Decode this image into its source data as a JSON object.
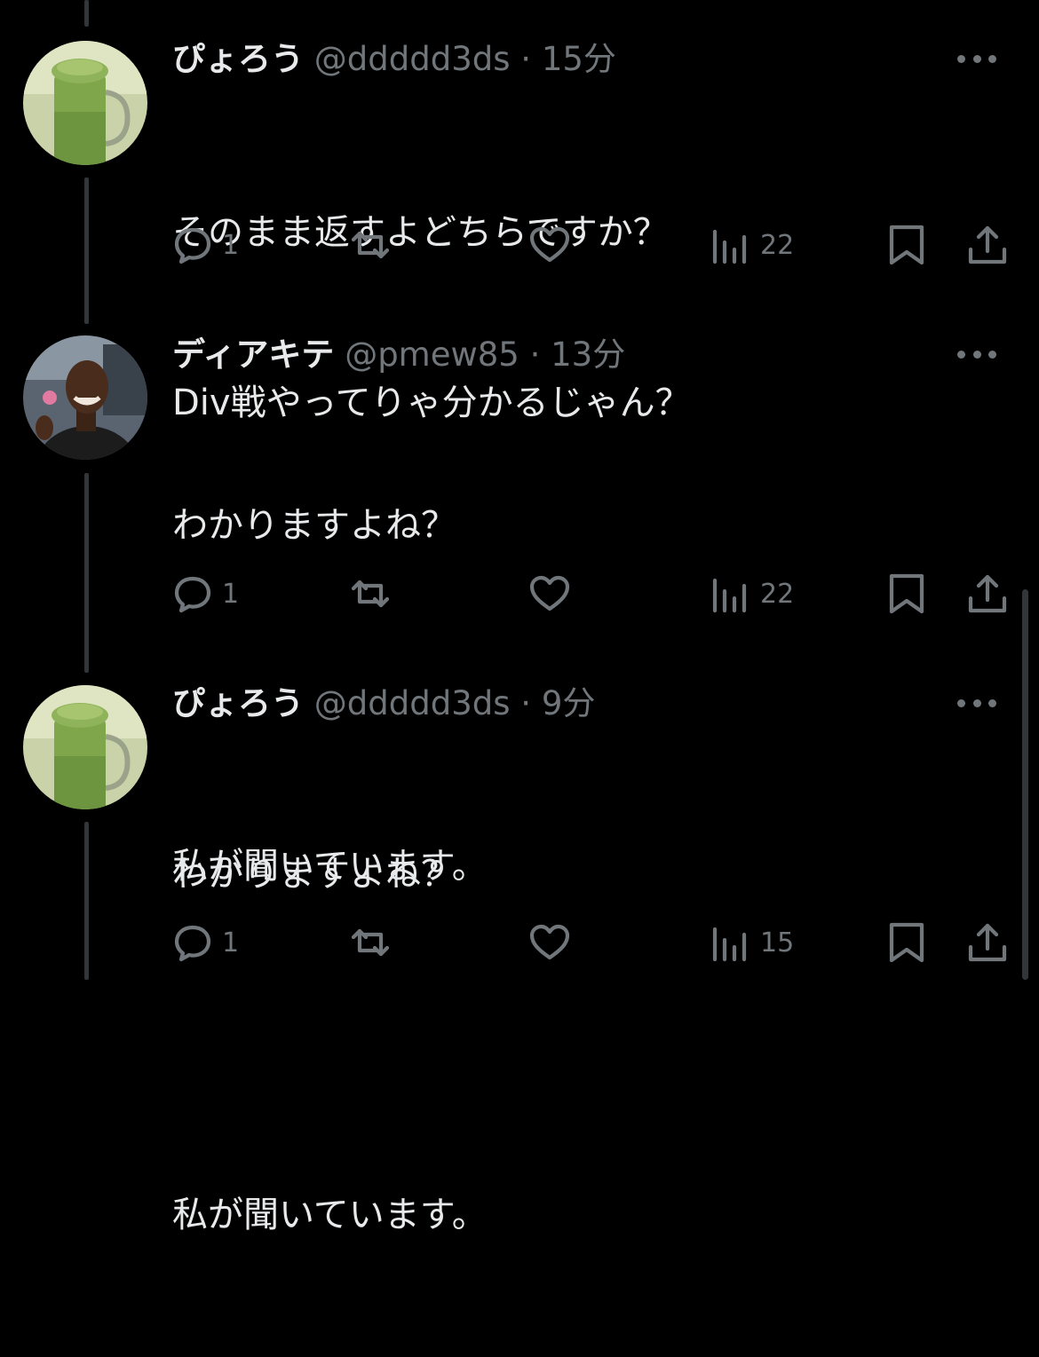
{
  "tweets": [
    {
      "name": "ぴょろう",
      "handle": "@ddddd3ds",
      "separator": "·",
      "time": "15分",
      "lines": [
        "そのまま返すよどちらですか？",
        "Div戦やってりゃ分かるじゃん？"
      ],
      "replies": "1",
      "views": "22",
      "avatar": "matcha-latte"
    },
    {
      "name": "ディアキテ",
      "handle": "@pmew85",
      "separator": "·",
      "time": "13分",
      "lines": [
        "わかりますよね？",
        "",
        "私が聞いています。"
      ],
      "replies": "1",
      "views": "22",
      "avatar": "person-photo"
    },
    {
      "name": "ぴょろう",
      "handle": "@ddddd3ds",
      "separator": "·",
      "time": "9分",
      "lines": [
        "わかりますよね？",
        "",
        "私が聞いています。"
      ],
      "replies": "1",
      "views": "15",
      "avatar": "matcha-latte"
    }
  ],
  "colors": {
    "background": "#000000",
    "text": "#e7e9ea",
    "muted": "#71767b",
    "thread_line": "#333639"
  }
}
